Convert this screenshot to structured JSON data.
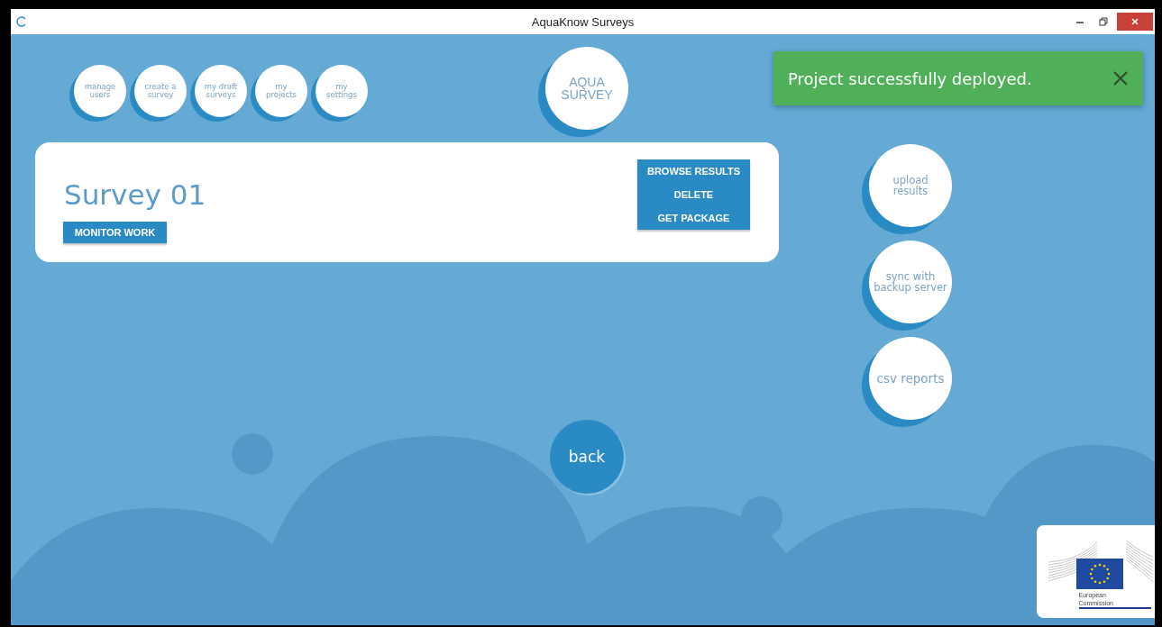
{
  "window": {
    "title": "AquaKnow Surveys"
  },
  "nav": [
    {
      "label": "manage\nusers"
    },
    {
      "label": "create a\nsurvey"
    },
    {
      "label": "my draft\nsurveys"
    },
    {
      "label": "my\nprojects"
    },
    {
      "label": "my\nsettings"
    }
  ],
  "brand": {
    "label": "AQUA\nSURVEY"
  },
  "survey_card": {
    "title": "Survey 01",
    "primary_button": "MONITOR WORK",
    "actions": [
      "BROWSE RESULTS",
      "DELETE",
      "GET PACKAGE"
    ]
  },
  "side_actions": [
    {
      "label": "upload\nresults"
    },
    {
      "label": "sync with\nbackup server"
    },
    {
      "label": "csv reports"
    }
  ],
  "back_button": "back",
  "toast": {
    "message": "Project successfully deployed."
  },
  "logo": {
    "caption": "European\nCommission"
  }
}
